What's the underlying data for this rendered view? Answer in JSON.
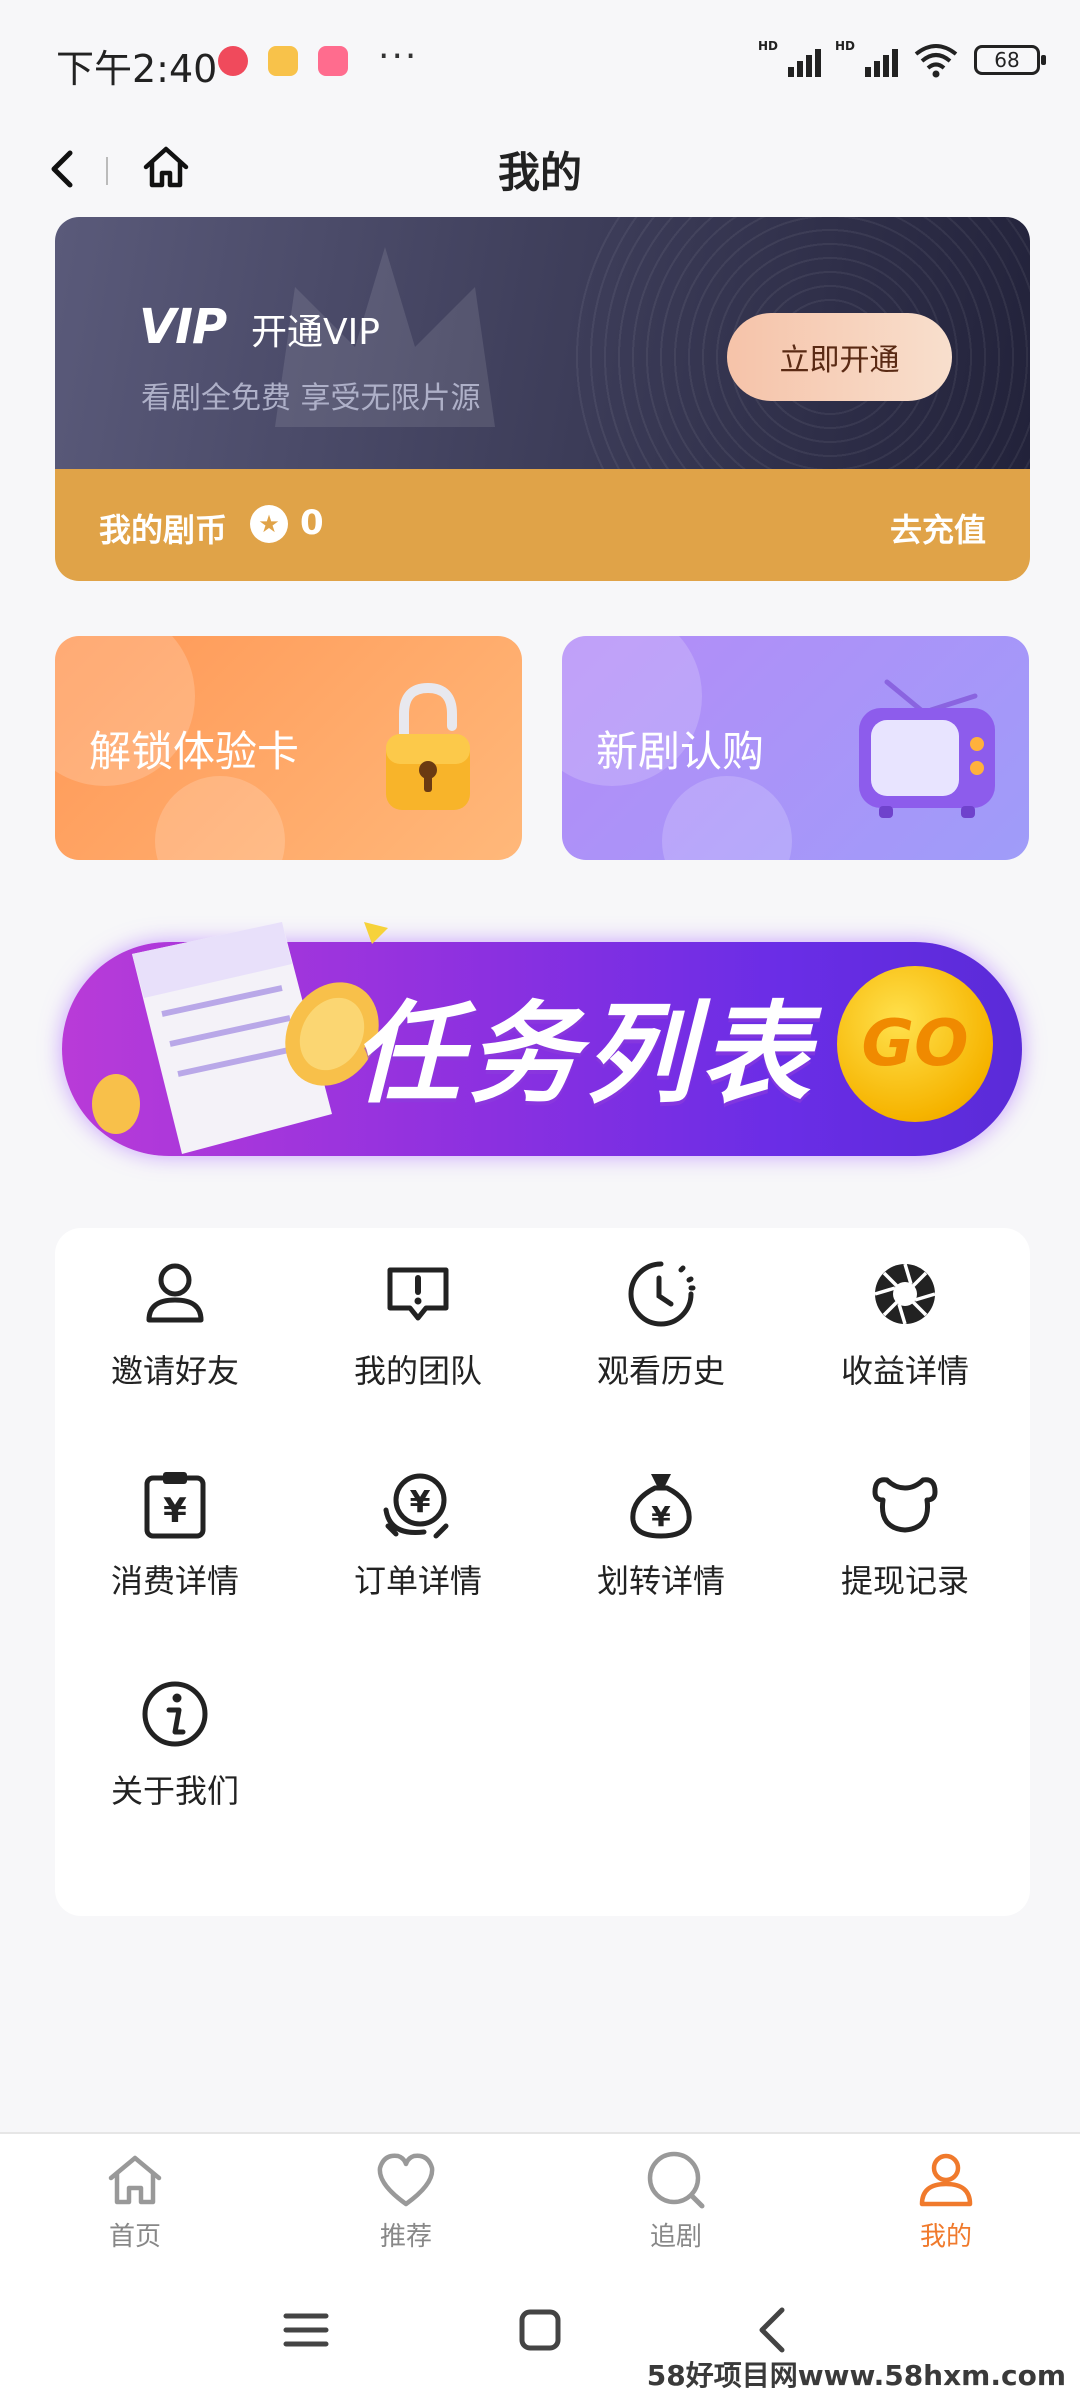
{
  "status_bar": {
    "time": "下午2:40",
    "more": "···",
    "battery": "68",
    "hd": "HD"
  },
  "header": {
    "title": "我的"
  },
  "vip": {
    "logo": "VIP",
    "title": "开通VIP",
    "subtitle": "看剧全免费 享受无限片源",
    "button": "立即开通",
    "coins_label": "我的剧币",
    "coins_value": "0",
    "recharge": "去充值"
  },
  "cards": [
    {
      "label": "解锁体验卡"
    },
    {
      "label": "新剧认购"
    }
  ],
  "task_banner": {
    "text": "任务列表",
    "go": "GO"
  },
  "grid": [
    {
      "label": "邀请好友",
      "icon": "user-icon"
    },
    {
      "label": "我的团队",
      "icon": "alert-chat-icon"
    },
    {
      "label": "观看历史",
      "icon": "clock-icon"
    },
    {
      "label": "收益详情",
      "icon": "aperture-icon"
    },
    {
      "label": "消费详情",
      "icon": "clipboard-yen-icon"
    },
    {
      "label": "订单详情",
      "icon": "yen-exchange-icon"
    },
    {
      "label": "划转详情",
      "icon": "money-bag-icon"
    },
    {
      "label": "提现记录",
      "icon": "bear-icon"
    },
    {
      "label": "关于我们",
      "icon": "info-icon"
    }
  ],
  "bottom_nav": [
    {
      "label": "首页",
      "icon": "home-icon"
    },
    {
      "label": "推荐",
      "icon": "heart-icon"
    },
    {
      "label": "追剧",
      "icon": "search-icon"
    },
    {
      "label": "我的",
      "icon": "profile-icon",
      "active": true
    }
  ],
  "colors": {
    "accent": "#f07a2c",
    "coin_bar": "#e0a348",
    "vip_dark": "#3c3c58"
  },
  "watermark": "58好项目网www.58hxm.com"
}
